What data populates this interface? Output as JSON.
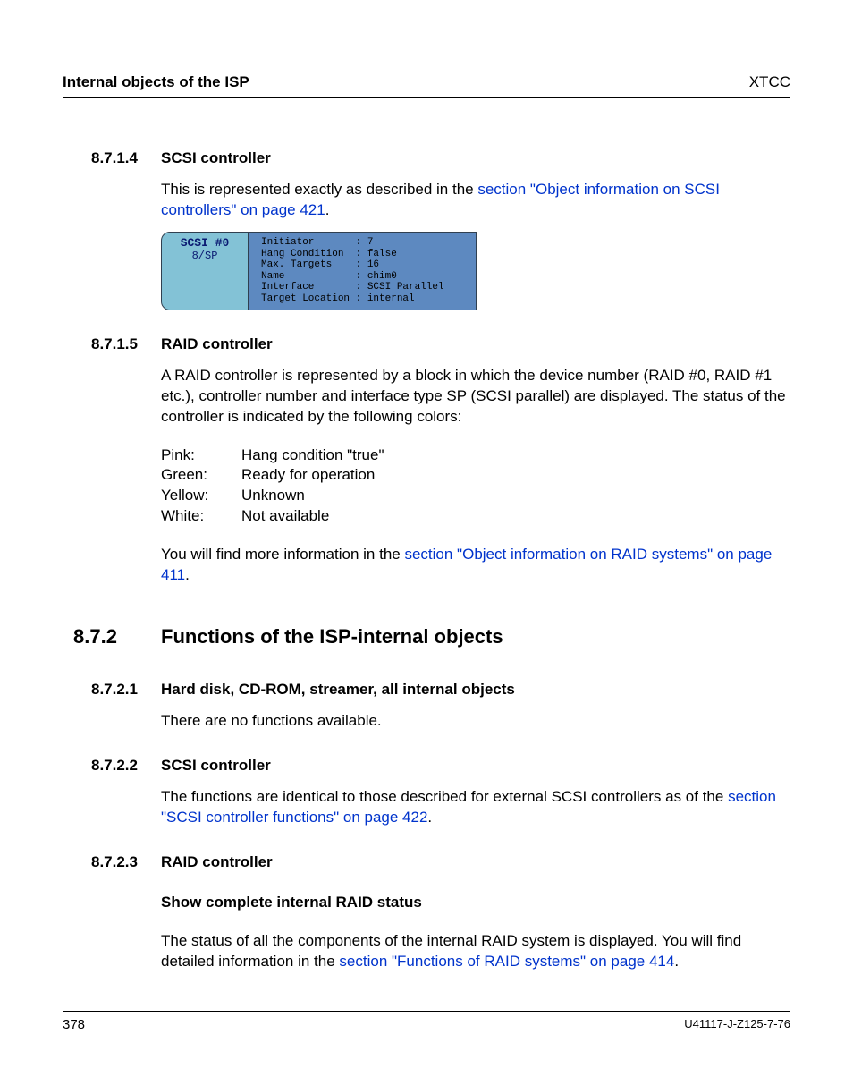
{
  "header": {
    "left": "Internal objects of the ISP",
    "right": "XTCC"
  },
  "s8714": {
    "num": "8.7.1.4",
    "title": "SCSI controller",
    "para_pre": "This is represented exactly as described in the ",
    "link": "section \"Object information on SCSI controllers\" on page 421",
    "para_post": "."
  },
  "figure": {
    "tab_line1": "SCSI #0",
    "tab_line2": "8/SP",
    "panel": "Initiator       : 7\nHang Condition  : false\nMax. Targets    : 16\nName            : chim0\nInterface       : SCSI Parallel\nTarget Location : internal"
  },
  "s8715": {
    "num": "8.7.1.5",
    "title": "RAID controller",
    "para1": "A RAID controller is represented by a block in which the device number (RAID #0, RAID #1 etc.), controller number and interface type SP (SCSI parallel) are displayed. The status of the controller is indicated by the following colors:",
    "status": [
      {
        "label": "Pink:",
        "desc": "Hang condition \"true\""
      },
      {
        "label": "Green:",
        "desc": "Ready for operation"
      },
      {
        "label": "Yellow:",
        "desc": "Unknown"
      },
      {
        "label": "White:",
        "desc": "Not available"
      }
    ],
    "para2_pre": "You will find more information in the ",
    "para2_link": "section \"Object information on RAID systems\" on page 411",
    "para2_post": "."
  },
  "s872": {
    "num": "8.7.2",
    "title": "Functions of the ISP-internal objects"
  },
  "s8721": {
    "num": "8.7.2.1",
    "title": "Hard disk, CD-ROM, streamer, all internal objects",
    "para": "There are no functions available."
  },
  "s8722": {
    "num": "8.7.2.2",
    "title": "SCSI controller",
    "para_pre": "The functions are identical to those described for external SCSI controllers as of the ",
    "link": "section \"SCSI controller functions\" on page 422",
    "para_post": "."
  },
  "s8723": {
    "num": "8.7.2.3",
    "title": "RAID controller",
    "sub": "Show complete internal RAID status",
    "para_pre": "The status of all the components of the internal RAID system is displayed. You will find detailed information in the ",
    "link": "section \"Functions of RAID systems\" on page 414",
    "para_post": "."
  },
  "footer": {
    "page": "378",
    "docref": "U41117-J-Z125-7-76"
  }
}
